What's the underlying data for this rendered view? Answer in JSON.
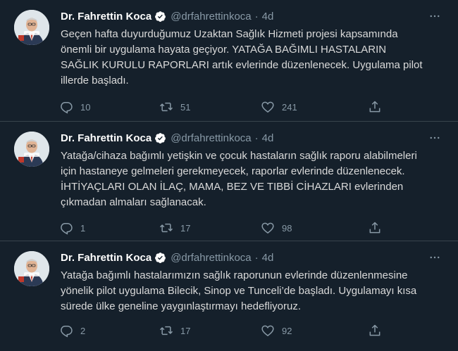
{
  "colors": {
    "background": "#15202b",
    "divider": "#38444d",
    "name": "#ffffff",
    "meta": "#8899a6",
    "verified": "#1da1f2"
  },
  "tweets": [
    {
      "author": "Dr. Fahrettin Koca",
      "handle": "@drfahrettinkoca",
      "separator": "·",
      "time": "4d",
      "verified_icon": "verified-badge-icon",
      "text": "Geçen hafta duyurduğumuz Uzaktan Sağlık Hizmeti projesi kapsamında\nönemli bir uygulama hayata geçiyor. YATAĞA BAĞIMLI HASTALARIN\nSAĞLIK KURULU RAPORLARI artık evlerinde düzenlenecek. Uygulama pilot\nillerde başladı.",
      "replies": "10",
      "retweets": "51",
      "likes": "241"
    },
    {
      "author": "Dr. Fahrettin Koca",
      "handle": "@drfahrettinkoca",
      "separator": "·",
      "time": "4d",
      "verified_icon": "verified-badge-icon",
      "text": "Yatağa/cihaza bağımlı yetişkin ve çocuk hastaların sağlık raporu alabilmeleri\niçin hastaneye gelmeleri gerekmeyecek, raporlar evlerinde düzenlenecek.\nİHTİYAÇLARI OLAN İLAÇ, MAMA, BEZ VE TIBBİ CİHAZLARI evlerinden\nçıkmadan almaları sağlanacak.",
      "replies": "1",
      "retweets": "17",
      "likes": "98"
    },
    {
      "author": "Dr. Fahrettin Koca",
      "handle": "@drfahrettinkoca",
      "separator": "·",
      "time": "4d",
      "verified_icon": "verified-badge-icon",
      "text": "Yatağa bağımlı hastalarımızın sağlık raporunun evlerinde düzenlenmesine\nyönelik pilot uygulama Bilecik, Sinop ve Tunceli’de başladı. Uygulamayı kısa\nsürede ülke geneline yaygınlaştırmayı hedefliyoruz.",
      "replies": "2",
      "retweets": "17",
      "likes": "92"
    }
  ],
  "icons": {
    "reply": "reply-icon",
    "retweet": "retweet-icon",
    "like": "heart-icon",
    "share": "share-icon",
    "more": "more-icon"
  }
}
